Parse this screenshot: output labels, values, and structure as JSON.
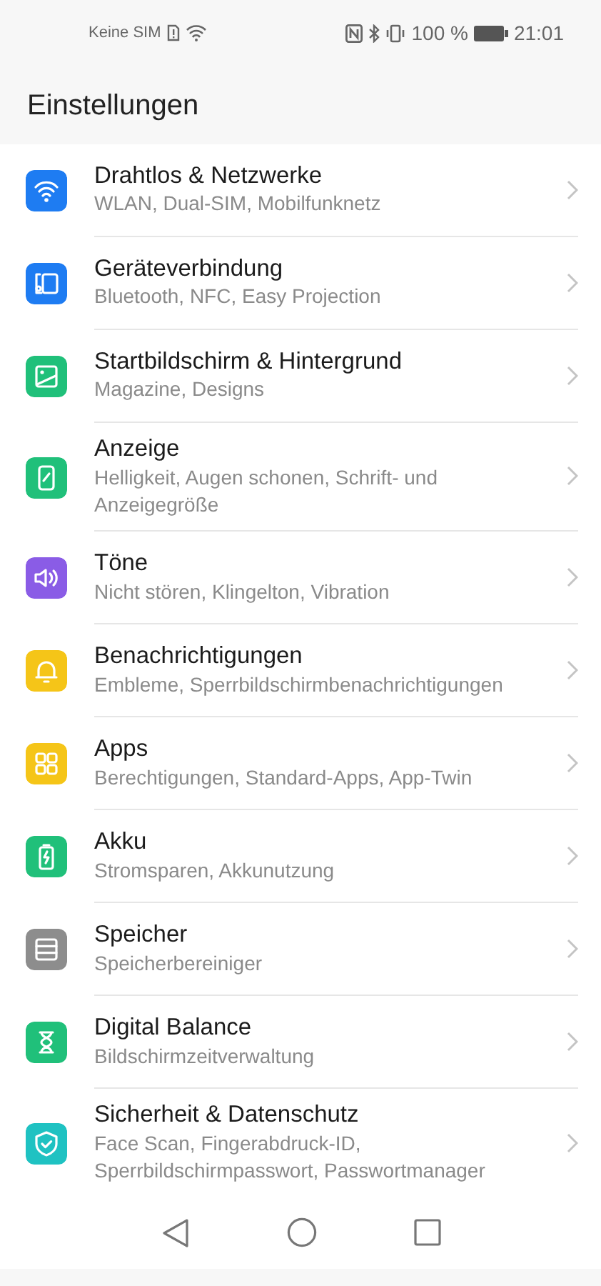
{
  "status_bar": {
    "carrier": "Keine SIM",
    "battery_text": "100 %",
    "time": "21:01"
  },
  "header": {
    "title": "Einstellungen"
  },
  "settings": [
    {
      "title": "Drahtlos & Netzwerke",
      "subtitle": "WLAN, Dual-SIM, Mobilfunknetz",
      "color": "#1e7cf2"
    },
    {
      "title": "Geräteverbindung",
      "subtitle": "Bluetooth, NFC, Easy Projection",
      "color": "#1e7cf2"
    },
    {
      "title": "Startbildschirm & Hintergrund",
      "subtitle": "Magazine, Designs",
      "color": "#20c07a"
    },
    {
      "title": "Anzeige",
      "subtitle": "Helligkeit, Augen schonen, Schrift- und Anzeigegröße",
      "color": "#20c07a"
    },
    {
      "title": "Töne",
      "subtitle": "Nicht stören, Klingelton, Vibration",
      "color": "#8a5ce6"
    },
    {
      "title": "Benachrichtigungen",
      "subtitle": "Embleme, Sperrbildschirmbenachrichtigungen",
      "color": "#f5c518"
    },
    {
      "title": "Apps",
      "subtitle": "Berechtigungen, Standard-Apps, App-Twin",
      "color": "#f5c518"
    },
    {
      "title": "Akku",
      "subtitle": "Stromsparen, Akkunutzung",
      "color": "#20c07a"
    },
    {
      "title": "Speicher",
      "subtitle": "Speicherbereiniger",
      "color": "#8d8d8d"
    },
    {
      "title": "Digital Balance",
      "subtitle": "Bildschirmzeitverwaltung",
      "color": "#20c07a"
    },
    {
      "title": "Sicherheit & Datenschutz",
      "subtitle": "Face Scan, Fingerabdruck-ID, Sperrbildschirmpasswort, Passwortmanager",
      "color": "#1fc2c2"
    }
  ]
}
